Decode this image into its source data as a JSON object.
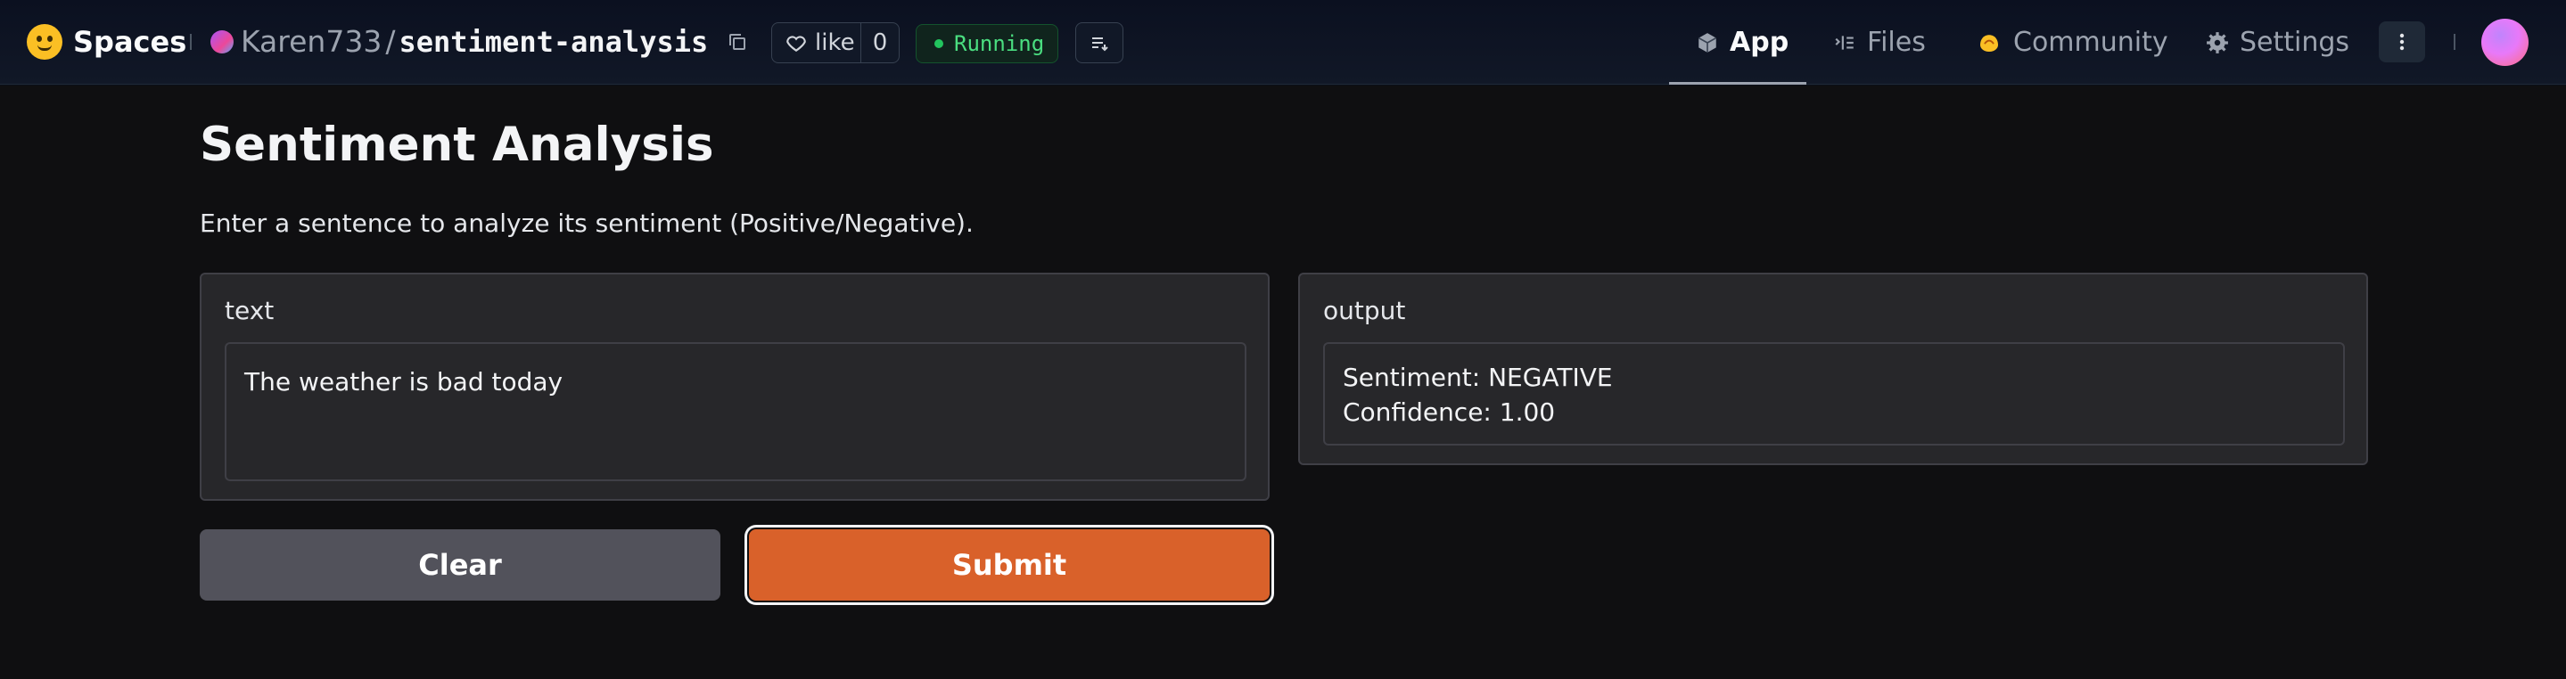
{
  "header": {
    "brand": "Spaces",
    "owner": "Karen733",
    "separator": "/",
    "repo": "sentiment-analysis",
    "like_label": "like",
    "like_count": "0",
    "status": "Running",
    "tabs": [
      {
        "label": "App",
        "icon": "cube-icon",
        "active": true
      },
      {
        "label": "Files",
        "icon": "files-icon",
        "active": false
      },
      {
        "label": "Community",
        "icon": "community-icon",
        "active": false
      },
      {
        "label": "Settings",
        "icon": "gear-icon",
        "active": false
      }
    ]
  },
  "app": {
    "title": "Sentiment Analysis",
    "description": "Enter a sentence to analyze its sentiment (Positive/Negative).",
    "input": {
      "label": "text",
      "value": "The weather is bad today"
    },
    "output": {
      "label": "output",
      "value": "Sentiment: NEGATIVE\nConfidence: 1.00"
    },
    "buttons": {
      "clear": "Clear",
      "submit": "Submit"
    }
  },
  "colors": {
    "accent": "#d9612a",
    "status_green": "#22c55e",
    "panel": "#27272a",
    "background": "#0f0f11"
  }
}
